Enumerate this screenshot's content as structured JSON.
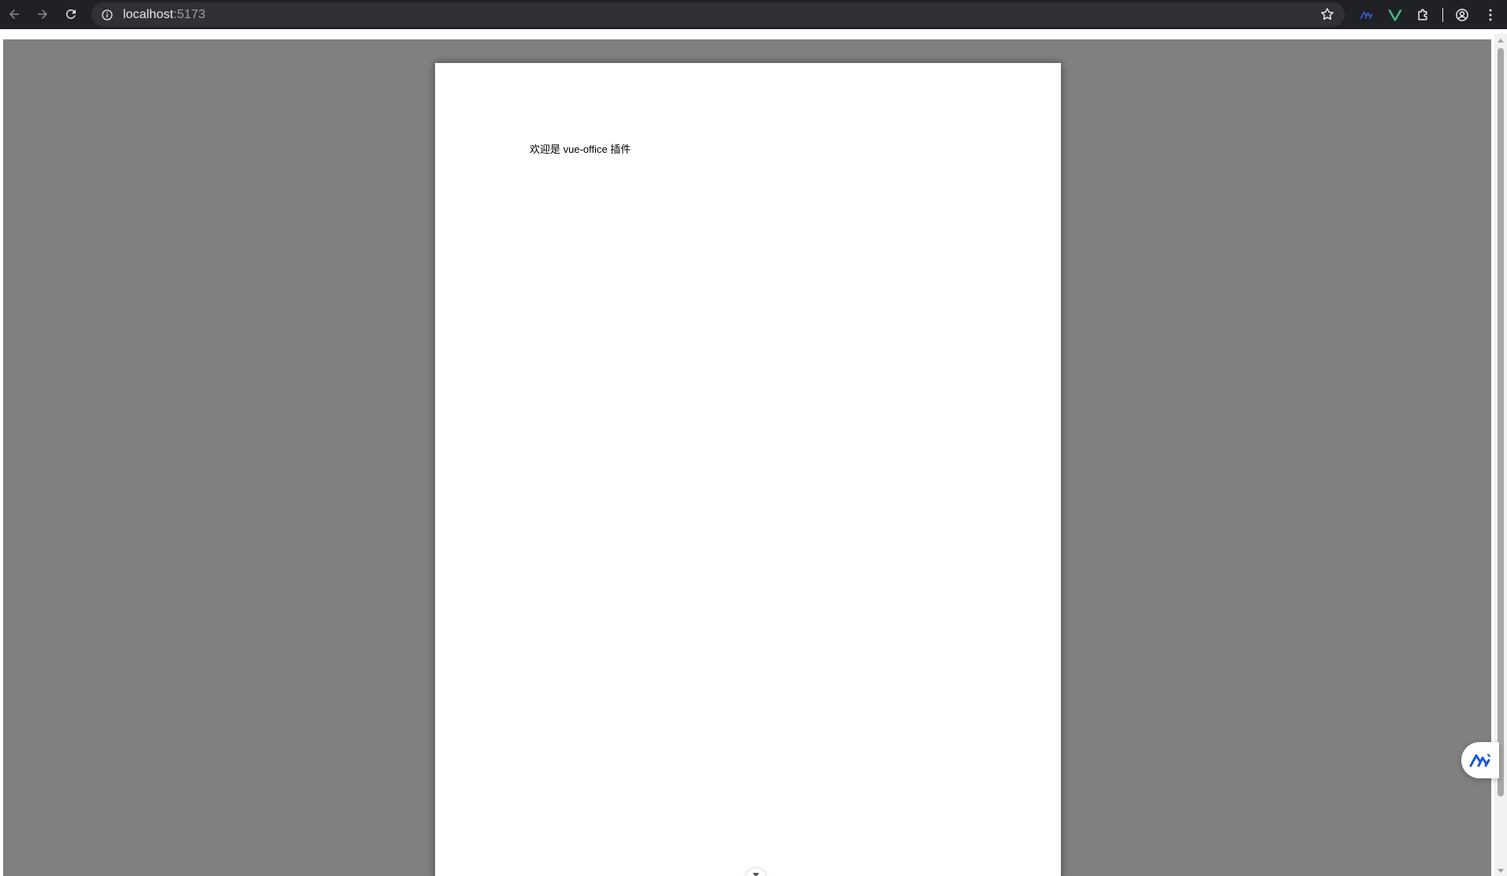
{
  "browser": {
    "back_icon": "arrow-left-icon",
    "forward_icon": "arrow-right-icon",
    "reload_icon": "reload-icon",
    "site_info_icon": "info-icon",
    "url_host": "localhost",
    "url_port": ":5173",
    "bookmark_icon": "star-icon",
    "extensions": [
      {
        "name": "merlin-extension-icon",
        "color": "#3b5bdb"
      },
      {
        "name": "vue-devtools-icon",
        "color": "#42b883"
      },
      {
        "name": "extensions-puzzle-icon",
        "color": "#e8eaed"
      }
    ],
    "profile_icon": "account-circle-icon",
    "menu_icon": "more-vert-icon"
  },
  "document": {
    "background_color": "#808080",
    "text": "欢迎是 vue-office 插件"
  },
  "floating_button": {
    "icon": "merlin-logo-icon",
    "color": "#1a56db"
  },
  "scroll_hint_icon": "chevron-down-icon"
}
